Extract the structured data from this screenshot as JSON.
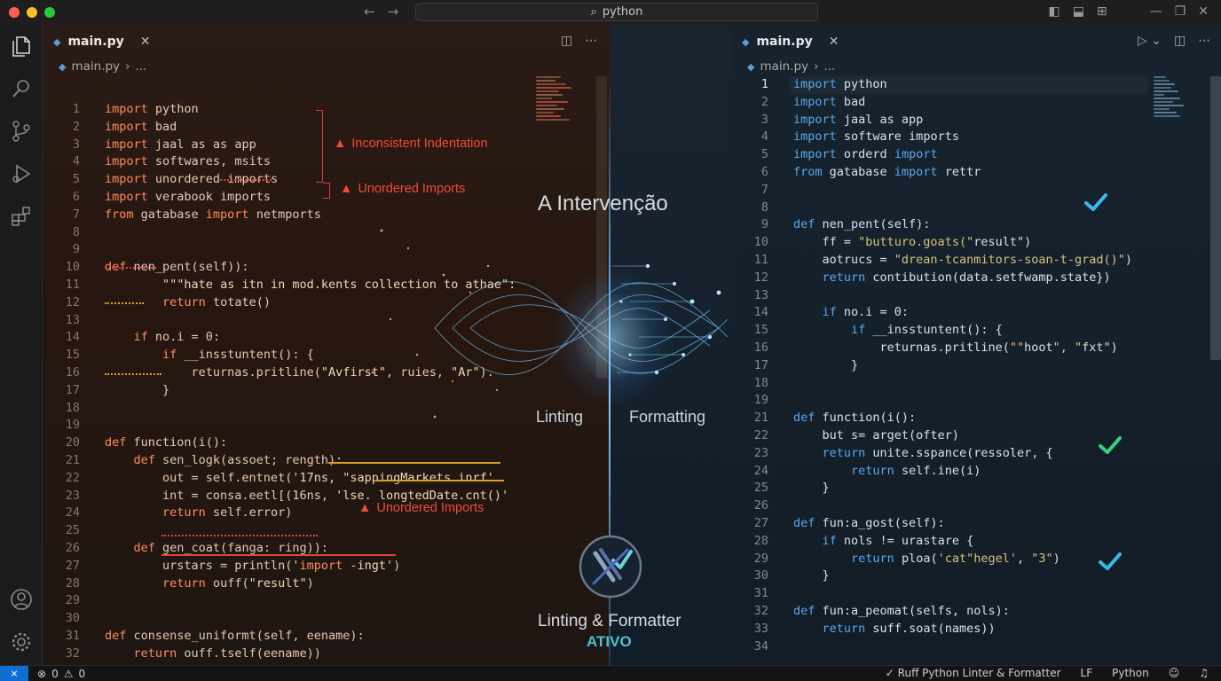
{
  "search": {
    "label": "python"
  },
  "left_editor": {
    "tab_label": "main.py",
    "breadcrumb": {
      "file": "main.py",
      "more": "..."
    },
    "lines": [
      {
        "n": "1",
        "t": "import python"
      },
      {
        "n": "2",
        "t": "import bad"
      },
      {
        "n": "3",
        "t": "import jaal as as app"
      },
      {
        "n": "4",
        "t": "import softwares, msits"
      },
      {
        "n": "5",
        "t": "import unordered imports"
      },
      {
        "n": "6",
        "t": "import verabook imports"
      },
      {
        "n": "7",
        "t": "from gatabase import netmports"
      },
      {
        "n": "8",
        "t": ""
      },
      {
        "n": "9",
        "t": ""
      },
      {
        "n": "10",
        "t": "def nen_pent(self)):"
      },
      {
        "n": "11",
        "t": "        \"\"\"hate as itn in mod.kents collection to athae\":"
      },
      {
        "n": "12",
        "t": "        return totate()"
      },
      {
        "n": "13",
        "t": ""
      },
      {
        "n": "14",
        "t": "    if no.i = 0:"
      },
      {
        "n": "15",
        "t": "        if __insstuntent(): {"
      },
      {
        "n": "16",
        "t": "            returnas.pritline(\"Avfirst\", ruies, \"Ar\")."
      },
      {
        "n": "17",
        "t": "        }"
      },
      {
        "n": "18",
        "t": ""
      },
      {
        "n": "19",
        "t": ""
      },
      {
        "n": "20",
        "t": "def function(i():"
      },
      {
        "n": "21",
        "t": "    def sen_logk(assoet; rength):"
      },
      {
        "n": "22",
        "t": "        out = self.entnet('17ns, \"sappingMarkets inrf'"
      },
      {
        "n": "23",
        "t": "        int = consa.eetl[(16ns, 'lse. longtedDate.cnt()'"
      },
      {
        "n": "24",
        "t": "        return self.error)"
      },
      {
        "n": "25",
        "t": ""
      },
      {
        "n": "26",
        "t": "    def gen_coat(fanga: ring)):"
      },
      {
        "n": "27",
        "t": "        urstars = println('import -ingt')"
      },
      {
        "n": "28",
        "t": "        return ouff(\"result\")"
      },
      {
        "n": "29",
        "t": ""
      },
      {
        "n": "30",
        "t": ""
      },
      {
        "n": "31",
        "t": "def consense_uniformt(self, eename):"
      },
      {
        "n": "32",
        "t": "    return ouff.tself(eename))"
      },
      {
        "n": "33",
        "t": ""
      },
      {
        "n": "34",
        "t": ""
      }
    ],
    "warnings": {
      "w1": "Inconsistent Indentation",
      "w2": "Unordered Imports",
      "w3": "Unordered Imports"
    }
  },
  "right_editor": {
    "tab_label": "main.py",
    "breadcrumb": {
      "file": "main.py",
      "more": "..."
    },
    "lines": [
      {
        "n": "1",
        "t": "import python"
      },
      {
        "n": "2",
        "t": "import bad"
      },
      {
        "n": "3",
        "t": "import jaal as app"
      },
      {
        "n": "4",
        "t": "import software imports"
      },
      {
        "n": "5",
        "t": "import orderd import"
      },
      {
        "n": "6",
        "t": "from gatabase import rettr"
      },
      {
        "n": "7",
        "t": ""
      },
      {
        "n": "8",
        "t": ""
      },
      {
        "n": "9",
        "t": "def nen_pent(self):"
      },
      {
        "n": "10",
        "t": "    ff = \"butturo.goats(\"result\")"
      },
      {
        "n": "11",
        "t": "    aotrucs = \"drean-tcanmitors-soan-t-grad()\")"
      },
      {
        "n": "12",
        "t": "    return contibution(data.setfwamp.state})"
      },
      {
        "n": "13",
        "t": ""
      },
      {
        "n": "14",
        "t": "    if no.i = 0:"
      },
      {
        "n": "15",
        "t": "        if __insstuntent(): {"
      },
      {
        "n": "16",
        "t": "            returnas.pritline(\"\"hoot\", \"fxt\")"
      },
      {
        "n": "17",
        "t": "        }"
      },
      {
        "n": "18",
        "t": ""
      },
      {
        "n": "19",
        "t": ""
      },
      {
        "n": "21",
        "t": "def function(i():"
      },
      {
        "n": "22",
        "t": "    but s= arget(ofter)"
      },
      {
        "n": "23",
        "t": "    return unite.sspance(ressoler, {"
      },
      {
        "n": "24",
        "t": "        return self.ine(i)"
      },
      {
        "n": "25",
        "t": "    }"
      },
      {
        "n": "26",
        "t": ""
      },
      {
        "n": "27",
        "t": "def fun:a_gost(self):"
      },
      {
        "n": "28",
        "t": "    if nols != urastare {"
      },
      {
        "n": "29",
        "t": "        return ploa('cat\"hegel', \"3\")"
      },
      {
        "n": "30",
        "t": "    }"
      },
      {
        "n": "31",
        "t": ""
      },
      {
        "n": "32",
        "t": "def fun:a_peomat(selfs, nols):"
      },
      {
        "n": "33",
        "t": "    return suff.soat(names))"
      },
      {
        "n": "34",
        "t": ""
      }
    ]
  },
  "center": {
    "heading": "A Intervenção",
    "lint_label": "Linting",
    "format_label": "Formatting",
    "brand": "Linting & Formatter",
    "status": "ATIVO"
  },
  "statusbar": {
    "problems": "0",
    "warnings": "0",
    "linter": "Ruff Python Linter & Formatter",
    "eol": "LF",
    "language": "Python"
  },
  "colors": {
    "accent": "#0e6fd1",
    "warning": "#f04a3a",
    "check": "#3ab8e8"
  }
}
